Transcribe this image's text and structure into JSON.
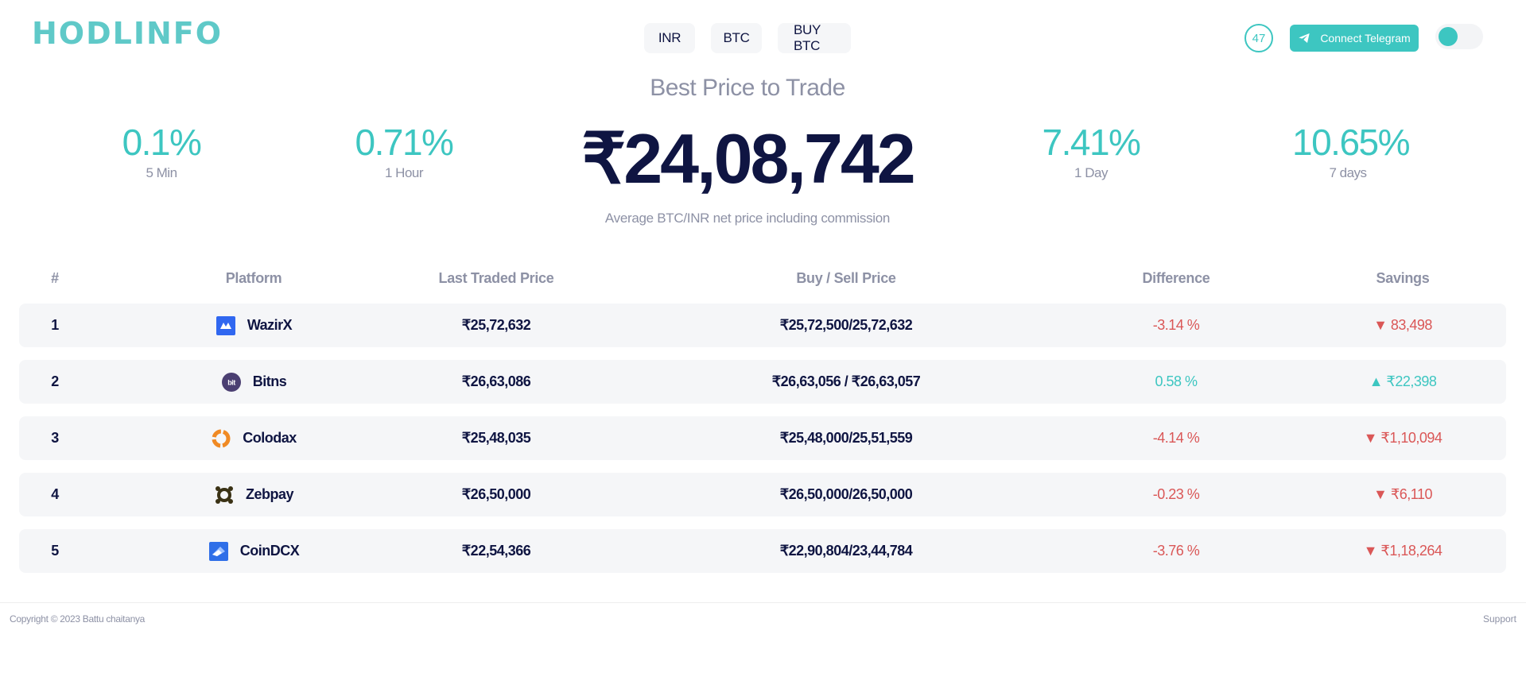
{
  "brand": {
    "logo": "HODLINFO",
    "accent": "#3dc6c1",
    "navy": "#0f1542"
  },
  "nav": {
    "inr": "INR",
    "btc": "BTC",
    "buy_btc": "BUY BTC"
  },
  "header": {
    "timer": "47",
    "telegram_label": "Connect Telegram"
  },
  "hero": {
    "title": "Best Price to Trade",
    "price": "₹24,08,742",
    "note": "Average BTC/INR net price including commission",
    "stats": [
      {
        "pct": "0.1%",
        "label": "5 Min"
      },
      {
        "pct": "0.71%",
        "label": "1 Hour"
      },
      {
        "pct": "7.41%",
        "label": "1 Day"
      },
      {
        "pct": "10.65%",
        "label": "7 days"
      }
    ]
  },
  "table": {
    "headers": [
      "#",
      "Platform",
      "Last Traded Price",
      "Buy / Sell Price",
      "Difference",
      "Savings"
    ],
    "rows": [
      {
        "num": "1",
        "platform": "WazirX",
        "ltp": "₹25,72,632",
        "buy_sell": "₹25,72,500/25,72,632",
        "diff": "-3.14 %",
        "savings": "▼ 83,498",
        "trend": "down",
        "icon": "wazirx-icon"
      },
      {
        "num": "2",
        "platform": "Bitns",
        "ltp": "₹26,63,086",
        "buy_sell": "₹26,63,056 / ₹26,63,057",
        "diff": "0.58 %",
        "savings": "▲ ₹22,398",
        "trend": "up",
        "icon": "bitns-icon"
      },
      {
        "num": "3",
        "platform": "Colodax",
        "ltp": "₹25,48,035",
        "buy_sell": "₹25,48,000/25,51,559",
        "diff": "-4.14 %",
        "savings": "▼ ₹1,10,094",
        "trend": "down",
        "icon": "colodax-icon"
      },
      {
        "num": "4",
        "platform": "Zebpay",
        "ltp": "₹26,50,000",
        "buy_sell": "₹26,50,000/26,50,000",
        "diff": "-0.23 %",
        "savings": "▼ ₹6,110",
        "trend": "down",
        "icon": "zebpay-icon"
      },
      {
        "num": "5",
        "platform": "CoinDCX",
        "ltp": "₹22,54,366",
        "buy_sell": "₹22,90,804/23,44,784",
        "diff": "-3.76 %",
        "savings": "▼ ₹1,18,264",
        "trend": "down",
        "icon": "coindcx-icon"
      }
    ]
  },
  "footer": {
    "copyright": "Copyright © 2023 Battu chaitanya",
    "support": "Support"
  }
}
